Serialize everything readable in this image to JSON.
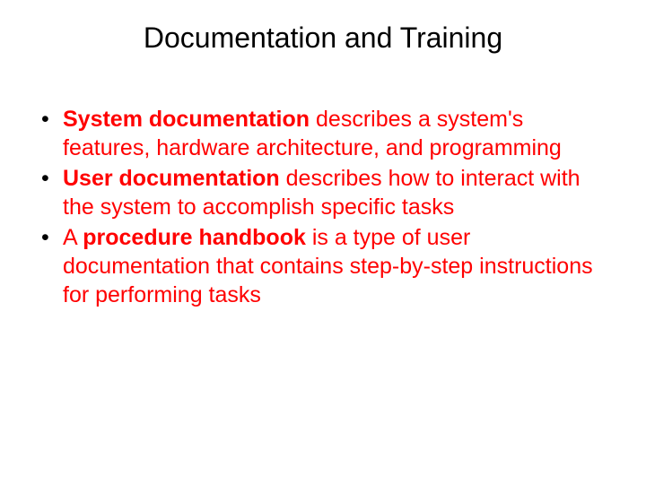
{
  "title": "Documentation and Training",
  "bullets": [
    {
      "term": "System documentation",
      "rest": " describes a system's features, hardware architecture, and programming"
    },
    {
      "term": "User documentation",
      "rest": " describes how to interact with the system to accomplish specific tasks"
    },
    {
      "term_prefix": "A ",
      "term": "procedure handbook",
      "rest": " is a type of user documentation that contains step-by-step instructions for performing tasks"
    }
  ]
}
